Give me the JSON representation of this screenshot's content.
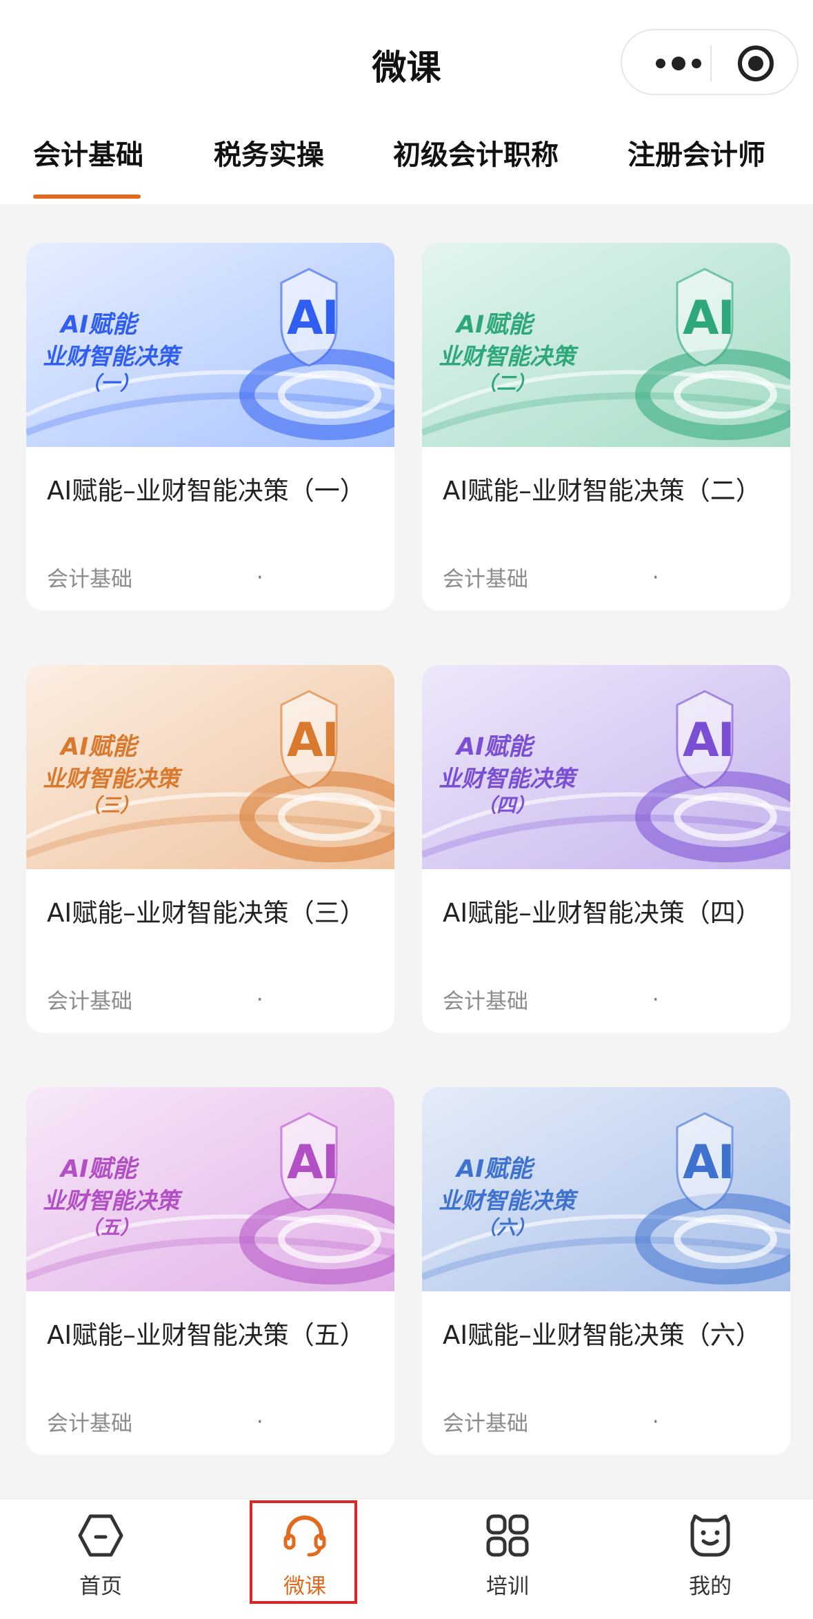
{
  "header": {
    "title": "微课"
  },
  "tabs": [
    {
      "label": "会计基础",
      "active": true
    },
    {
      "label": "税务实操",
      "active": false
    },
    {
      "label": "初级会计职称",
      "active": false
    },
    {
      "label": "注册会计师",
      "active": false
    }
  ],
  "courses": [
    {
      "thumb": {
        "line1": "AI赋能",
        "line2": "业财智能决策",
        "line3": "（一）",
        "badge": "AI"
      },
      "title": "AI赋能–业财智能决策（一）",
      "category": "会计基础",
      "dot": "·",
      "accent": "#2f5ef0",
      "bg_light": "#e6edff",
      "bg_mid": "#a9c4ff"
    },
    {
      "thumb": {
        "line1": "AI赋能",
        "line2": "业财智能决策",
        "line3": "（二）",
        "badge": "AI"
      },
      "title": "AI赋能–业财智能决策（二）",
      "category": "会计基础",
      "dot": "·",
      "accent": "#2ea77a",
      "bg_light": "#e3f5ee",
      "bg_mid": "#a6dcc6"
    },
    {
      "thumb": {
        "line1": "AI赋能",
        "line2": "业财智能决策",
        "line3": "（三）",
        "badge": "AI"
      },
      "title": "AI赋能–业财智能决策（三）",
      "category": "会计基础",
      "dot": "·",
      "accent": "#d9792e",
      "bg_light": "#fbeee3",
      "bg_mid": "#efc29c"
    },
    {
      "thumb": {
        "line1": "AI赋能",
        "line2": "业财智能决策",
        "line3": "（四）",
        "badge": "AI"
      },
      "title": "AI赋能–业财智能决策（四）",
      "category": "会计基础",
      "dot": "·",
      "accent": "#7a4fd3",
      "bg_light": "#eee8fa",
      "bg_mid": "#c6b4ee"
    },
    {
      "thumb": {
        "line1": "AI赋能",
        "line2": "业财智能决策",
        "line3": "（五）",
        "badge": "AI"
      },
      "title": "AI赋能–业财智能决策（五）",
      "category": "会计基础",
      "dot": "·",
      "accent": "#b24fc4",
      "bg_light": "#f7e8f8",
      "bg_mid": "#e1b1e8"
    },
    {
      "thumb": {
        "line1": "AI赋能",
        "line2": "业财智能决策",
        "line3": "（六）",
        "badge": "AI"
      },
      "title": "AI赋能–业财智能决策（六）",
      "category": "会计基础",
      "dot": "·",
      "accent": "#3f72cf",
      "bg_light": "#e5ecf8",
      "bg_mid": "#a9c0ea"
    }
  ],
  "bottom_nav": [
    {
      "label": "首页",
      "icon": "home-hexagon-icon",
      "active": false
    },
    {
      "label": "微课",
      "icon": "headset-icon",
      "active": true
    },
    {
      "label": "培训",
      "icon": "grid-apps-icon",
      "active": false
    },
    {
      "label": "我的",
      "icon": "smiley-face-icon",
      "active": false
    }
  ],
  "colors": {
    "accent": "#e26a1d",
    "highlight_box": "#e02424"
  }
}
